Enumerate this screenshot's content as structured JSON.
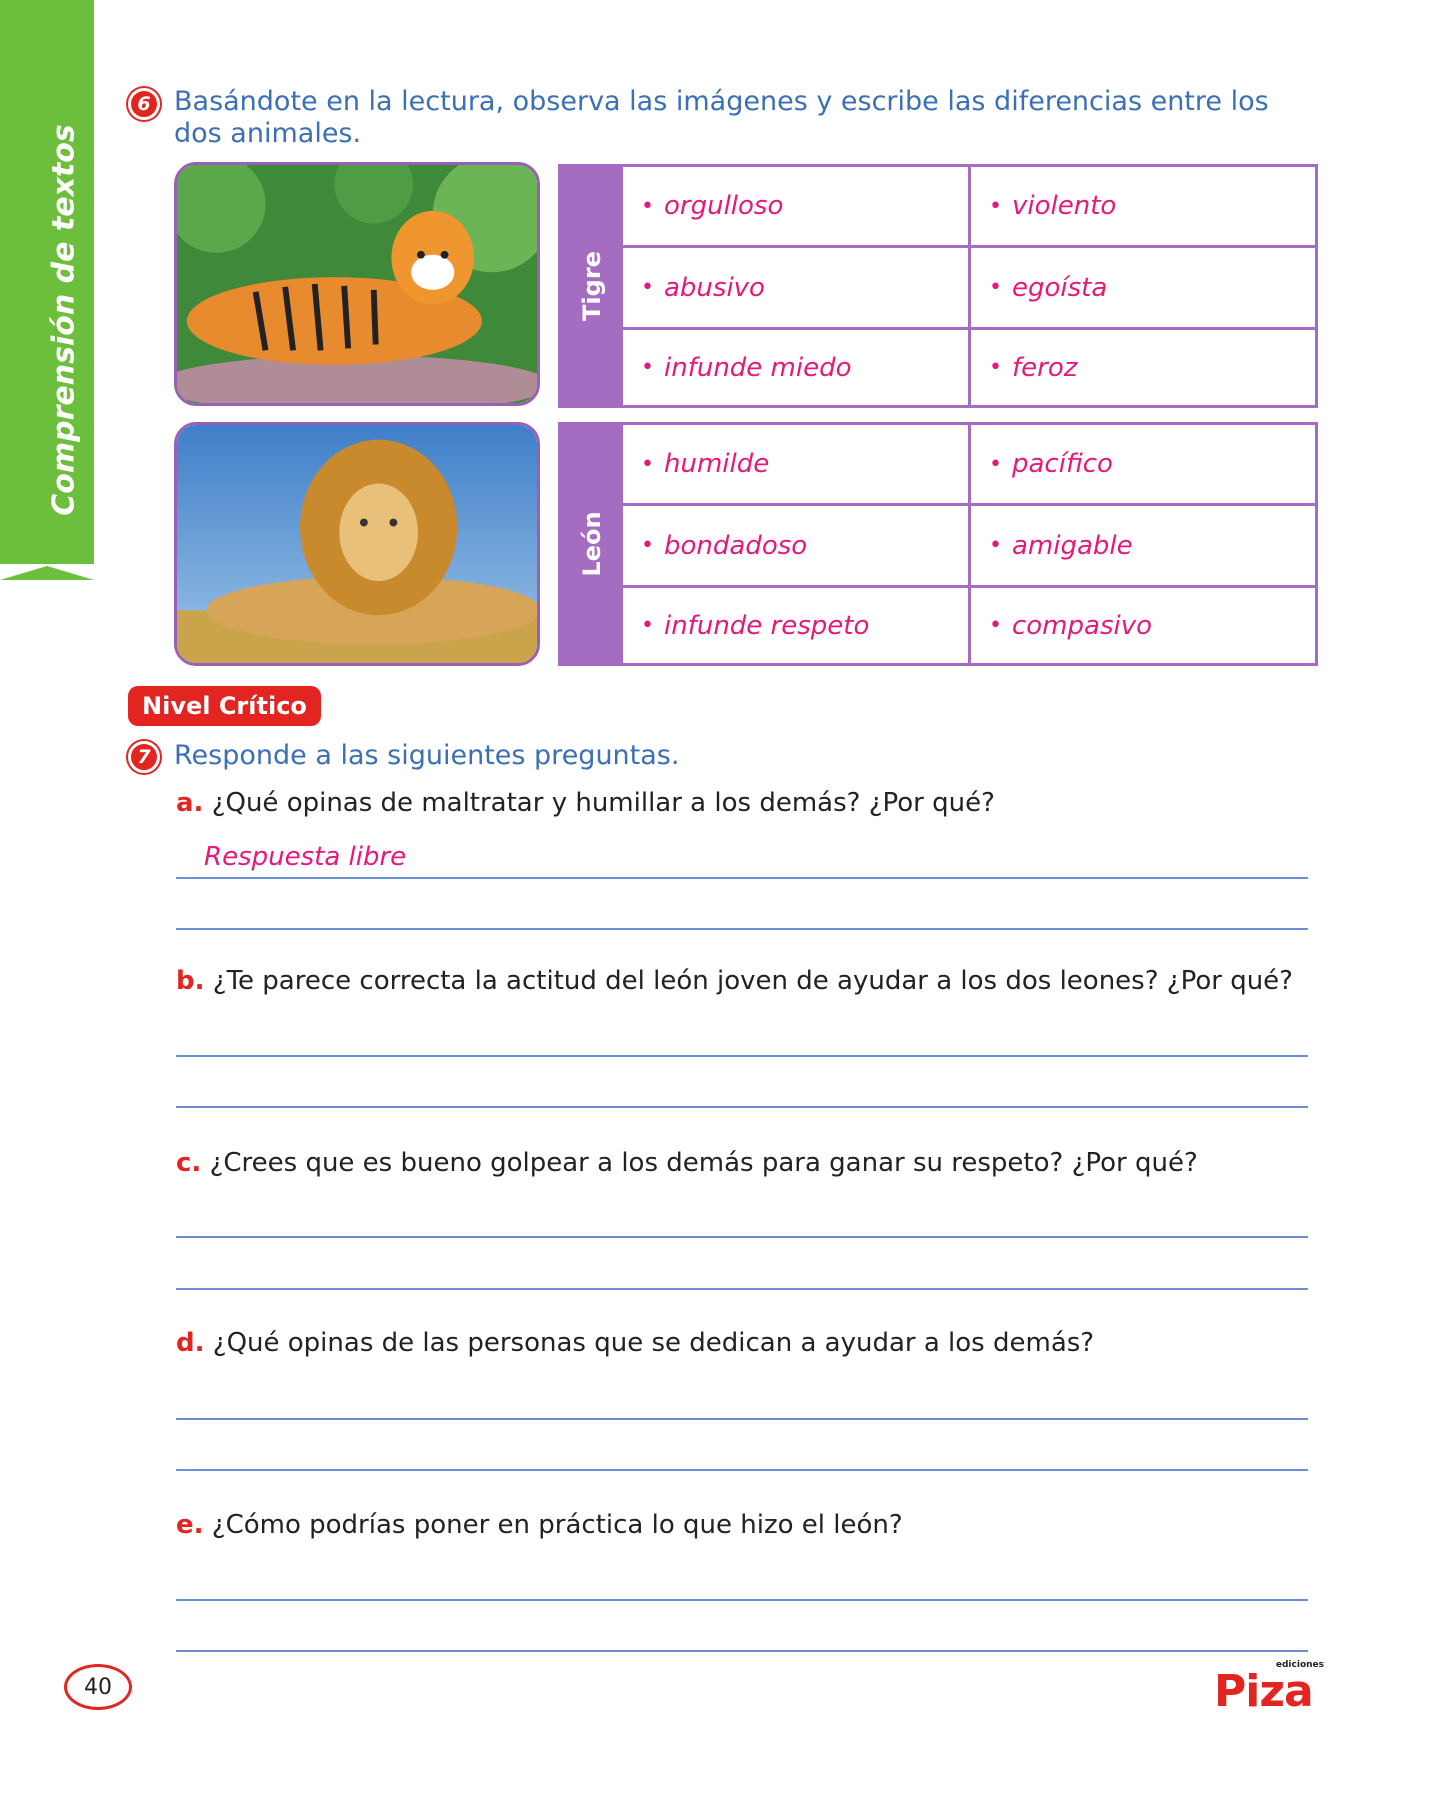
{
  "side_tab": {
    "label": "Comprensión de textos"
  },
  "exercise6": {
    "number": "6",
    "instruction": "Basándote en la lectura, observa las imágenes y escribe las diferencias entre los dos animales.",
    "tigre": {
      "label": "Tigre",
      "cells": [
        "orgulloso",
        "violento",
        "abusivo",
        "egoísta",
        "infunde miedo",
        "feroz"
      ]
    },
    "leon": {
      "label": "León",
      "cells": [
        "humilde",
        "pacífico",
        "bondadoso",
        "amigable",
        "infunde respeto",
        "compasivo"
      ]
    }
  },
  "level_badge": "Nivel Crítico",
  "exercise7": {
    "number": "7",
    "instruction": "Responde a las siguientes preguntas.",
    "questions": [
      {
        "letter": "a.",
        "text": "¿Qué opinas de maltratar y humillar a los demás? ¿Por qué?",
        "answer": "Respuesta libre"
      },
      {
        "letter": "b.",
        "text": "¿Te parece correcta la actitud del león joven de ayudar a los dos leones? ¿Por qué?"
      },
      {
        "letter": "c.",
        "text": "¿Crees que es bueno golpear a los demás para ganar su respeto? ¿Por qué?"
      },
      {
        "letter": "d.",
        "text": "¿Qué opinas de las personas que se dedican a ayudar a los demás?"
      },
      {
        "letter": "e.",
        "text": "¿Cómo podrías poner en práctica lo que hizo el león?"
      }
    ]
  },
  "footer": {
    "page_number": "40",
    "logo_small": "ediciones",
    "logo_main": "Piza"
  },
  "colors": {
    "green": "#6cbf3c",
    "red": "#e32521",
    "purple": "#a56dc2",
    "blue": "#3b6fb6",
    "magenta": "#e6197a"
  }
}
